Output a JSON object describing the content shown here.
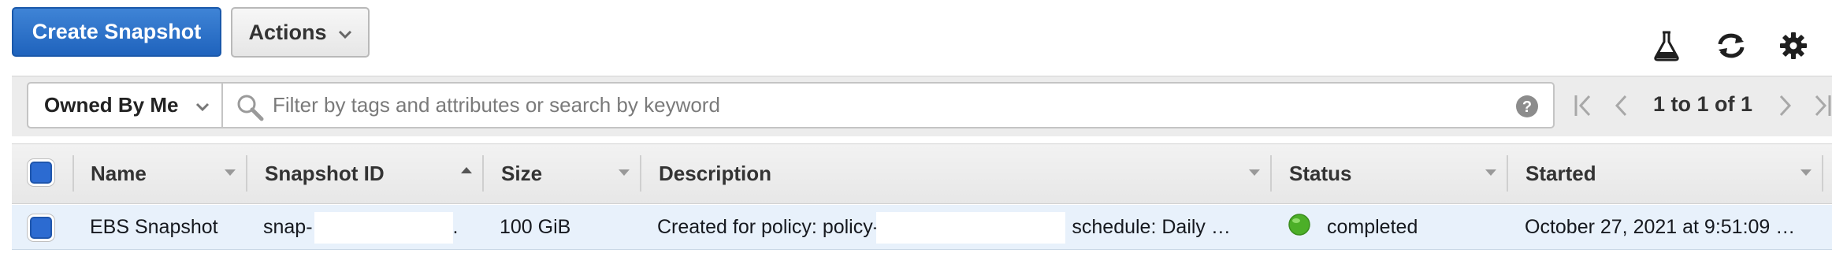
{
  "toolbar": {
    "create_label": "Create Snapshot",
    "actions_label": "Actions",
    "icons": [
      "flask-icon",
      "refresh-icon",
      "gear-icon"
    ]
  },
  "filter": {
    "owner_selected": "Owned By Me",
    "search_placeholder": "Filter by tags and attributes or search by keyword",
    "pagination_text": "1 to 1 of 1"
  },
  "table": {
    "columns": [
      "Name",
      "Snapshot ID",
      "Size",
      "Description",
      "Status",
      "Started"
    ],
    "sorted_column": "Snapshot ID",
    "rows": [
      {
        "name": "EBS Snapshot",
        "snapshot_id_prefix": "snap-",
        "snapshot_id_suffix": ".",
        "size": "100 GiB",
        "description_prefix": "Created for policy: policy-(",
        "description_suffix": "schedule: Daily …",
        "status": "completed",
        "status_color": "#4caf28",
        "started": "October 27, 2021 at 9:51:09 …"
      }
    ]
  },
  "colors": {
    "primary": "#1f63bd",
    "selected_row": "#e8f1fb"
  }
}
